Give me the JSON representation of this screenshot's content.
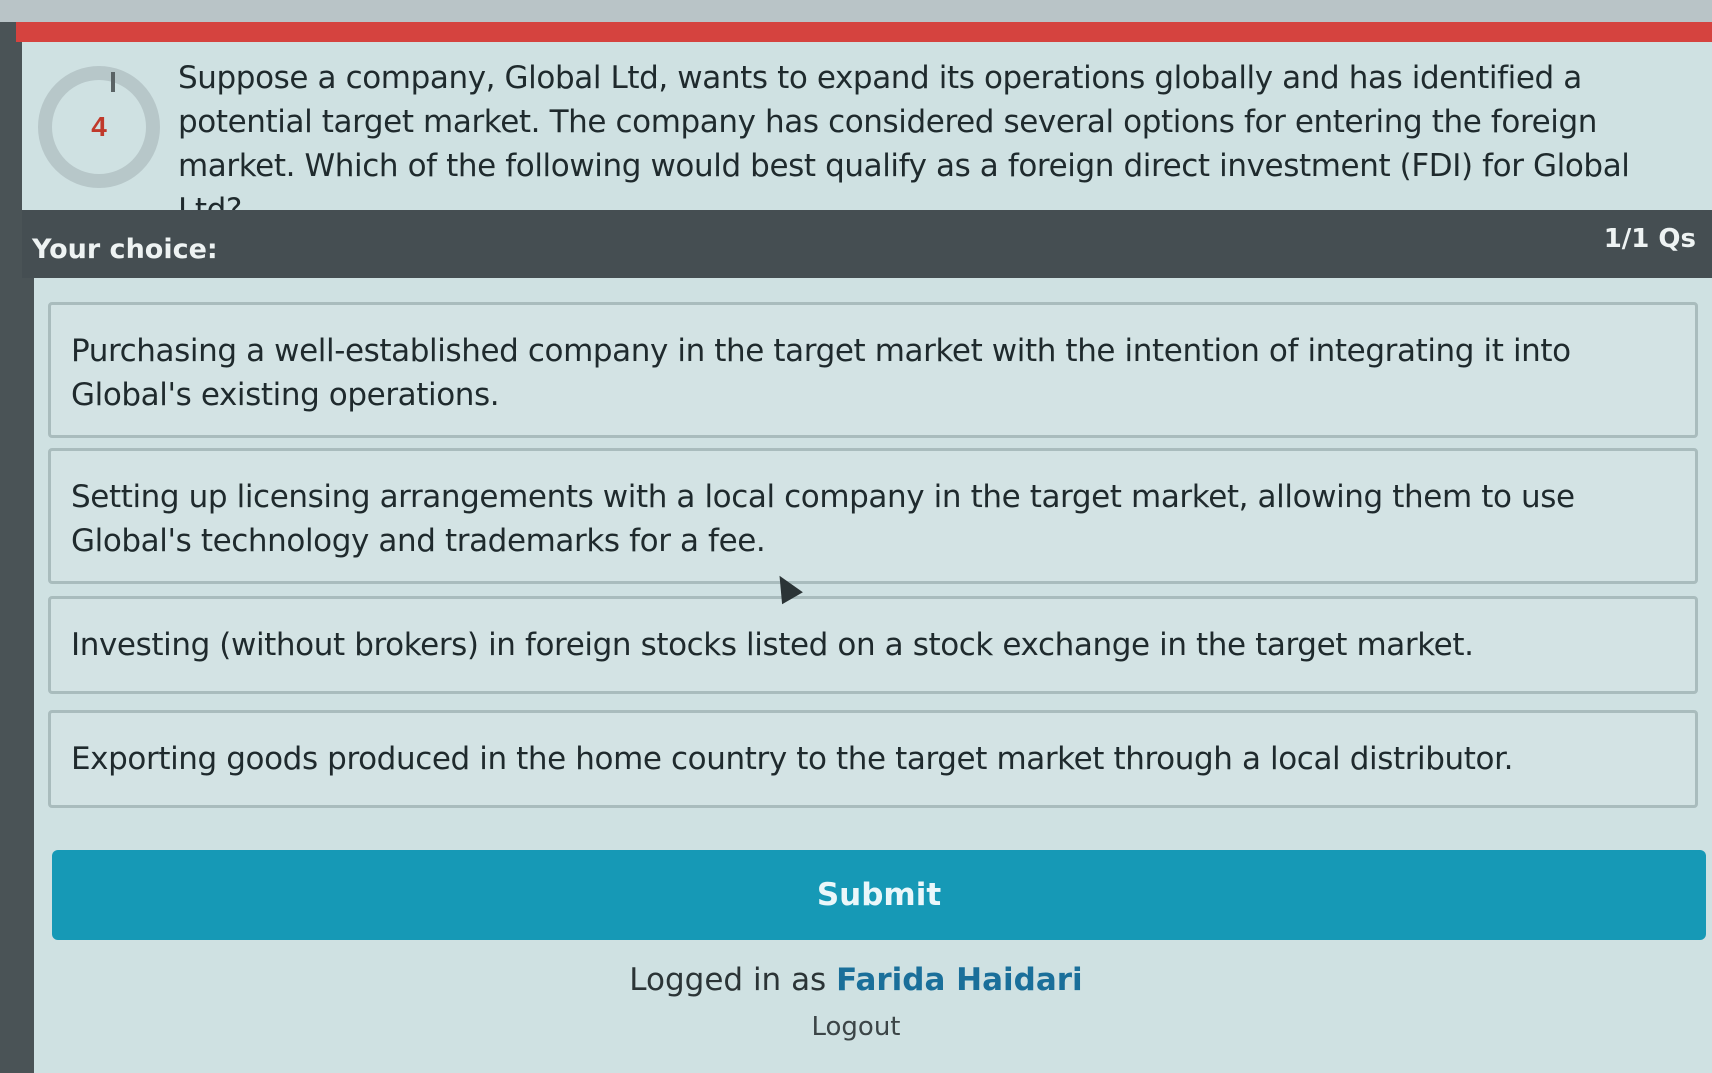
{
  "timer": {
    "value": "4"
  },
  "question": {
    "text": "Suppose a company, Global Ltd, wants to expand its operations globally and has identified a potential target market. The company has considered several options for entering the foreign market. Which of the following would best qualify as a foreign direct investment (FDI) for Global Ltd?"
  },
  "choice_header": {
    "label": "Your choice:",
    "counter": "1/1 Qs"
  },
  "options": [
    {
      "text": "Purchasing a well-established company in the target market with the intention of integrating it into Global's existing operations."
    },
    {
      "text": "Setting up licensing arrangements with a local company in the target market, allowing them to use Global's technology and trademarks for a fee."
    },
    {
      "text": "Investing (without brokers) in foreign stocks listed on a stock exchange in the target market."
    },
    {
      "text": "Exporting goods produced in the home country to the target market through a local distributor."
    }
  ],
  "submit": {
    "label": "Submit"
  },
  "footer": {
    "logged_in_prefix": "Logged in as",
    "user_name": "Farida Haidari",
    "logout_label": "Logout"
  },
  "colors": {
    "accent": "#1699b6",
    "header_red": "#d5433f",
    "timer_text": "#c0392b"
  },
  "icons": {
    "cursor": "mouse-pointer-icon"
  }
}
